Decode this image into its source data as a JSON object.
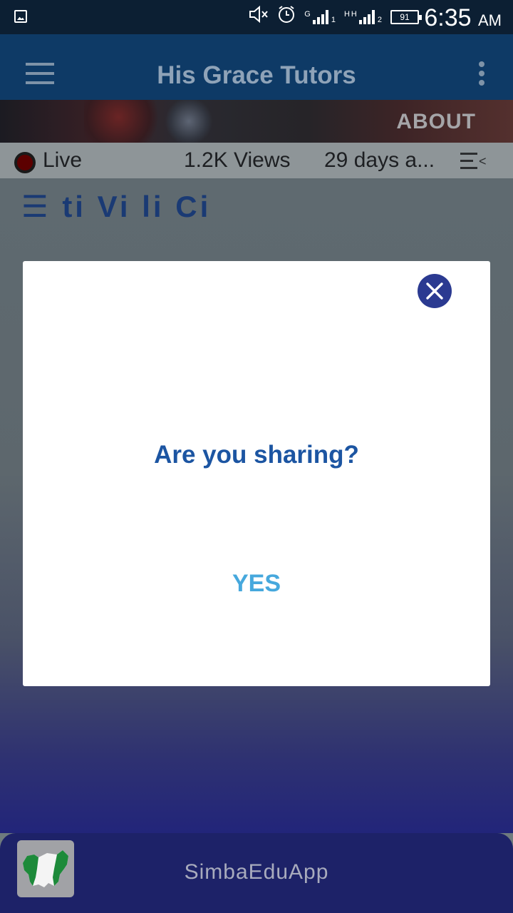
{
  "status_bar": {
    "gallery_icon": "image-icon",
    "mute_icon": "volume-mute-icon",
    "alarm_icon": "alarm-icon",
    "sim1_net": "G",
    "sim1_index": "1",
    "sim2_net": "H",
    "sim2_net_b": "H",
    "sim2_index": "2",
    "battery": "91",
    "time": "6:35",
    "ampm": "AM"
  },
  "app_bar": {
    "title": "His Grace Tutors",
    "menu_icon": "hamburger-menu-icon",
    "overflow_icon": "more-vert-icon"
  },
  "banner": {
    "about_label": "ABOUT"
  },
  "video_meta": {
    "live_label": "Live",
    "views": "1.2K Views",
    "age": "29 days a...",
    "playlist_icon": "playlist-icon"
  },
  "background_heading": "☰ ti  Vi li Ci",
  "dialog": {
    "question": "Are you sharing?",
    "confirm_label": "YES",
    "close_icon": "close-icon"
  },
  "bottom_bar": {
    "label": "SimbaEduApp",
    "logo": "nigeria-map-logo"
  },
  "colors": {
    "status_bar": "#0c1f33",
    "app_bar": "#0e3a66",
    "dialog_question": "#1c55a2",
    "confirm_button": "#46a8dd",
    "close_button": "#2b3a91",
    "bottom_bar": "#1d2268"
  }
}
